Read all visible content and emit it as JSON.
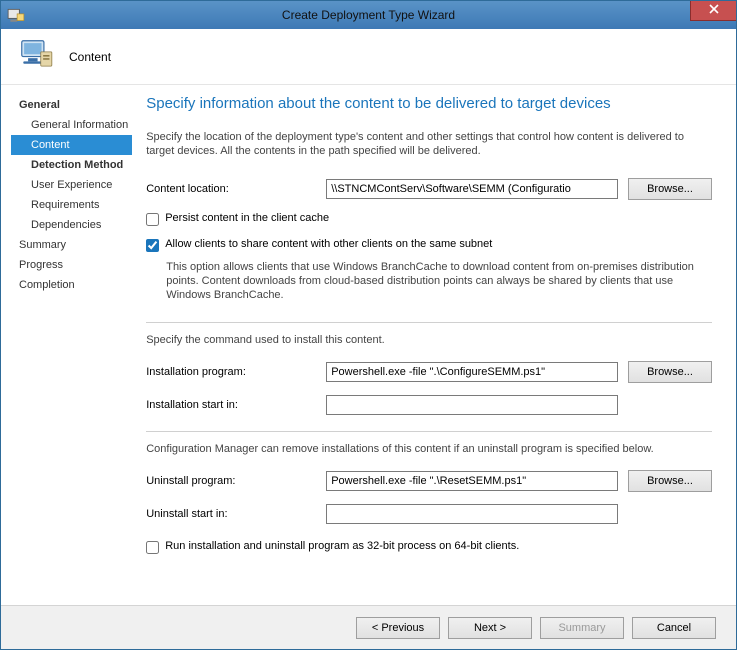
{
  "window": {
    "title": "Create Deployment Type Wizard"
  },
  "header": {
    "page_name": "Content"
  },
  "sidebar": {
    "items": [
      {
        "label": "General",
        "kind": "top",
        "bold": true,
        "selected": false
      },
      {
        "label": "General Information",
        "kind": "sub",
        "bold": false,
        "selected": false
      },
      {
        "label": "Content",
        "kind": "sub",
        "bold": false,
        "selected": true
      },
      {
        "label": "Detection Method",
        "kind": "sub",
        "bold": true,
        "selected": false
      },
      {
        "label": "User Experience",
        "kind": "sub",
        "bold": false,
        "selected": false
      },
      {
        "label": "Requirements",
        "kind": "sub",
        "bold": false,
        "selected": false
      },
      {
        "label": "Dependencies",
        "kind": "sub",
        "bold": false,
        "selected": false
      },
      {
        "label": "Summary",
        "kind": "top",
        "bold": false,
        "selected": false
      },
      {
        "label": "Progress",
        "kind": "top",
        "bold": false,
        "selected": false
      },
      {
        "label": "Completion",
        "kind": "top",
        "bold": false,
        "selected": false
      }
    ]
  },
  "main": {
    "heading": "Specify information about the content to be delivered to target devices",
    "description": "Specify the location of the deployment type's content and other settings that control how content is delivered to target devices. All the contents in the path specified will be delivered.",
    "content_location_label": "Content location:",
    "content_location_value": "\\\\STNCMContServ\\Software\\SEMM (Configuratio",
    "browse_label": "Browse...",
    "persist_label": "Persist content in the client cache",
    "persist_checked": false,
    "allow_share_label": "Allow clients to share content with other clients on the same subnet",
    "allow_share_checked": true,
    "branchcache_help": "This option allows clients that use Windows BranchCache to download content from on-premises distribution points. Content downloads from cloud-based distribution points can always be shared by clients that use Windows BranchCache.",
    "install_section_label": "Specify the command used to install this content.",
    "install_program_label": "Installation program:",
    "install_program_value": "Powershell.exe -file \".\\ConfigureSEMM.ps1\"",
    "install_start_label": "Installation start in:",
    "install_start_value": "",
    "uninstall_note": "Configuration Manager can remove installations of this content if an uninstall program is specified below.",
    "uninstall_program_label": "Uninstall program:",
    "uninstall_program_value": "Powershell.exe -file \".\\ResetSEMM.ps1\"",
    "uninstall_start_label": "Uninstall start in:",
    "uninstall_start_value": "",
    "run32_label": "Run installation and uninstall program as 32-bit process on 64-bit clients.",
    "run32_checked": false
  },
  "footer": {
    "previous": "< Previous",
    "next": "Next >",
    "summary": "Summary",
    "cancel": "Cancel"
  }
}
